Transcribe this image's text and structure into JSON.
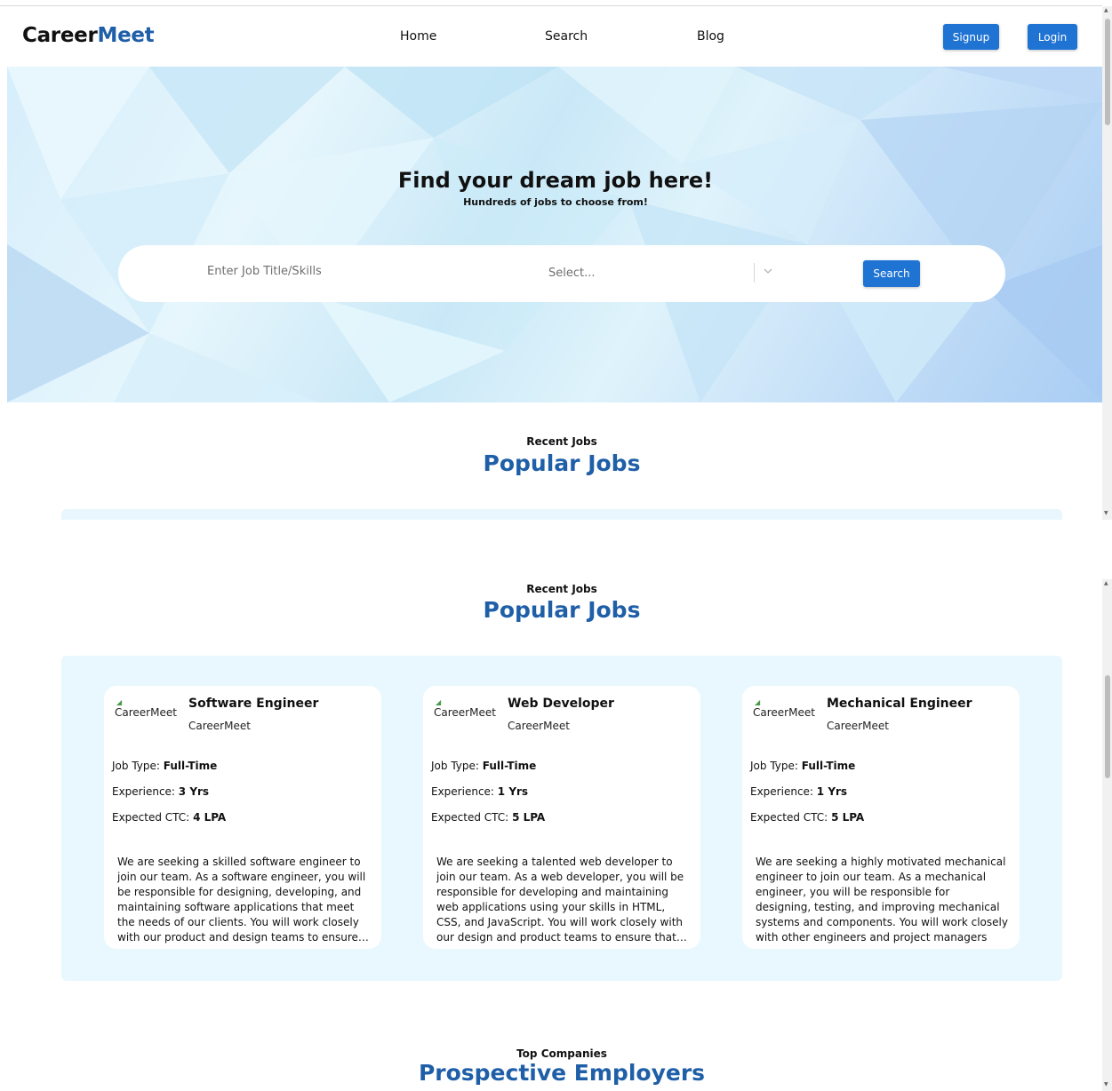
{
  "brand": {
    "name_part1": "Career",
    "name_part2": "Meet"
  },
  "nav": {
    "home": "Home",
    "search": "Search",
    "blog": "Blog",
    "signup": "Signup",
    "login": "Login"
  },
  "hero": {
    "title": "Find your dream job here!",
    "subtitle": "Hundreds of jobs to choose from!",
    "search_placeholder": "Enter Job Title/Skills",
    "select_placeholder": "Select...",
    "search_button": "Search"
  },
  "recent_jobs": {
    "eyebrow": "Recent Jobs",
    "title": "Popular Jobs"
  },
  "jobs": [
    {
      "logo_alt": "CareerMeet",
      "title": "Software Engineer",
      "company": "CareerMeet",
      "job_type_label": "Job Type:",
      "job_type": "Full-Time",
      "experience_label": "Experience:",
      "experience": "3 Yrs",
      "ctc_label": "Expected CTC:",
      "ctc": "4 LPA",
      "description": "We are seeking a skilled software engineer to join our team. As a software engineer, you will be responsible for designing, developing, and maintaining software applications that meet the needs of our clients. You will work closely with our product and design teams to ensure…"
    },
    {
      "logo_alt": "CareerMeet",
      "title": "Web Developer",
      "company": "CareerMeet",
      "job_type_label": "Job Type:",
      "job_type": "Full-Time",
      "experience_label": "Experience:",
      "experience": "1 Yrs",
      "ctc_label": "Expected CTC:",
      "ctc": "5 LPA",
      "description": "We are seeking a talented web developer to join our team. As a web developer, you will be responsible for developing and maintaining web applications using your skills in HTML, CSS, and JavaScript. You will work closely with our design and product teams to ensure that…"
    },
    {
      "logo_alt": "CareerMeet",
      "title": "Mechanical Engineer",
      "company": "CareerMeet",
      "job_type_label": "Job Type:",
      "job_type": "Full-Time",
      "experience_label": "Experience:",
      "experience": "1 Yrs",
      "ctc_label": "Expected CTC:",
      "ctc": "5 LPA",
      "description": "We are seeking a highly motivated mechanical engineer to join our team. As a mechanical engineer, you will be responsible for designing, testing, and improving mechanical systems and components. You will work closely with other engineers and project managers to…"
    }
  ],
  "top_companies": {
    "eyebrow": "Top Companies",
    "title": "Prospective Employers"
  },
  "colors": {
    "brand_blue": "#1f5fa8",
    "button_blue": "#1f73d3",
    "jobs_bg": "#e8f8fe"
  },
  "icons": {
    "select_toggle": "chevron-down-icon",
    "logo_mark": "leaf-icon"
  }
}
